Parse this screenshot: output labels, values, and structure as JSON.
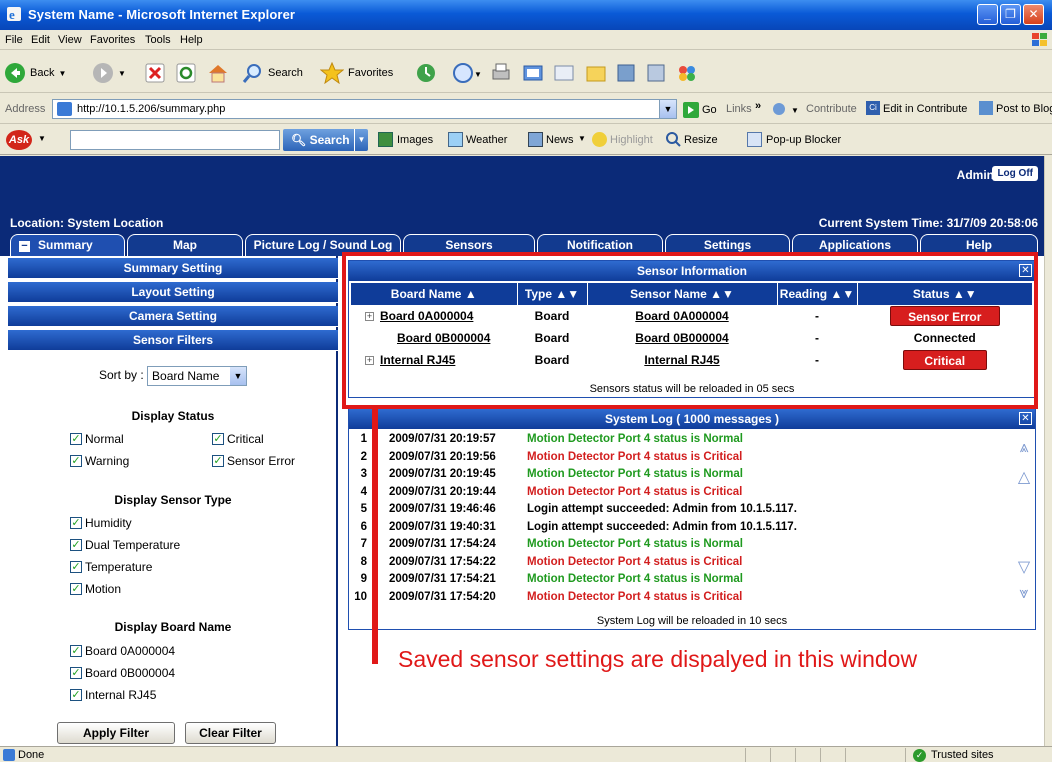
{
  "window": {
    "title": "System Name - Microsoft Internet Explorer",
    "minimize": "_",
    "maximize": "❐",
    "close": "✕"
  },
  "menu": [
    "File",
    "Edit",
    "View",
    "Favorites",
    "Tools",
    "Help"
  ],
  "toolbar": {
    "back": "Back",
    "search": "Search",
    "favorites": "Favorites"
  },
  "address": {
    "label": "Address",
    "url": "http://10.1.5.206/summary.php",
    "go": "Go",
    "links": "Links",
    "links_more": "»",
    "contribute": "Contribute",
    "edit_in_contribute": "Edit in Contribute",
    "post_to_blog": "Post to Blog"
  },
  "ask": {
    "logo": "Ask",
    "search": "Search",
    "images": "Images",
    "weather": "Weather",
    "news": "News",
    "highlight": "Highlight",
    "resize": "Resize",
    "popup_blocker": "Pop-up Blocker"
  },
  "banner": {
    "admin": "Admin",
    "logoff": "Log Off",
    "location": "Location: System Location",
    "time": "Current System Time: 31/7/09 20:58:06"
  },
  "tabs": [
    "Summary",
    "Map",
    "Picture Log / Sound Log",
    "Sensors",
    "Notification",
    "Settings",
    "Applications",
    "Help"
  ],
  "tab_icon": "−",
  "sidebar": {
    "headers": [
      "Summary Setting",
      "Layout Setting",
      "Camera Setting",
      "Sensor Filters"
    ],
    "sort_label": "Sort by :",
    "sort_value": "Board Name",
    "display_status_title": "Display Status",
    "status": [
      "Normal",
      "Critical",
      "Warning",
      "Sensor Error"
    ],
    "sensor_type_title": "Display Sensor Type",
    "sensor_types": [
      "Humidity",
      "Dual Temperature",
      "Temperature",
      "Motion"
    ],
    "board_name_title": "Display Board Name",
    "boards": [
      "Board 0A000004",
      "Board 0B000004",
      "Internal RJ45"
    ],
    "apply": "Apply Filter",
    "clear": "Clear Filter"
  },
  "sensor_panel": {
    "title": "Sensor Information",
    "columns": [
      "Board Name ▲",
      "Type ▲▼",
      "Sensor Name ▲▼",
      "Reading ▲▼",
      "Status ▲▼"
    ],
    "rows": [
      {
        "board": "Board 0A000004",
        "type": "Board",
        "sensor": "Board 0A000004",
        "reading": "-",
        "status": "Sensor Error"
      },
      {
        "board": "Board 0B000004",
        "type": "Board",
        "sensor": "Board 0B000004",
        "reading": "-",
        "status": "Connected"
      },
      {
        "board": "Internal RJ45",
        "type": "Board",
        "sensor": "Internal RJ45",
        "reading": "-",
        "status": "Critical"
      }
    ],
    "footer": "Sensors status will be reloaded in 05 secs"
  },
  "log_panel": {
    "title": "System Log ( 1000 messages )",
    "rows": [
      {
        "n": "1",
        "time": "2009/07/31 20:19:57",
        "msg": "Motion Detector Port 4 status is Normal",
        "level": "green"
      },
      {
        "n": "2",
        "time": "2009/07/31 20:19:56",
        "msg": "Motion Detector Port 4 status is Critical",
        "level": "red"
      },
      {
        "n": "3",
        "time": "2009/07/31 20:19:45",
        "msg": "Motion Detector Port 4 status is Normal",
        "level": "green"
      },
      {
        "n": "4",
        "time": "2009/07/31 20:19:44",
        "msg": "Motion Detector Port 4 status is Critical",
        "level": "red"
      },
      {
        "n": "5",
        "time": "2009/07/31 19:46:46",
        "msg": "Login attempt succeeded: Admin from 10.1.5.117.",
        "level": "black"
      },
      {
        "n": "6",
        "time": "2009/07/31 19:40:31",
        "msg": "Login attempt succeeded: Admin from 10.1.5.117.",
        "level": "black"
      },
      {
        "n": "7",
        "time": "2009/07/31 17:54:24",
        "msg": "Motion Detector Port 4 status is Normal",
        "level": "green"
      },
      {
        "n": "8",
        "time": "2009/07/31 17:54:22",
        "msg": "Motion Detector Port 4 status is Critical",
        "level": "red"
      },
      {
        "n": "9",
        "time": "2009/07/31 17:54:21",
        "msg": "Motion Detector Port 4 status is Normal",
        "level": "green"
      },
      {
        "n": "10",
        "time": "2009/07/31 17:54:20",
        "msg": "Motion Detector Port 4 status is Critical",
        "level": "red"
      }
    ],
    "footer": "System Log will be reloaded in 10 secs"
  },
  "annotation": "Saved sensor settings are dispalyed in this window",
  "status": {
    "done": "Done",
    "trusted": "Trusted sites"
  },
  "colors": {
    "banner": "#0b2a78",
    "critical": "#d71e1e",
    "normal_text": "#1f9a1f",
    "annotation": "#e01818"
  }
}
